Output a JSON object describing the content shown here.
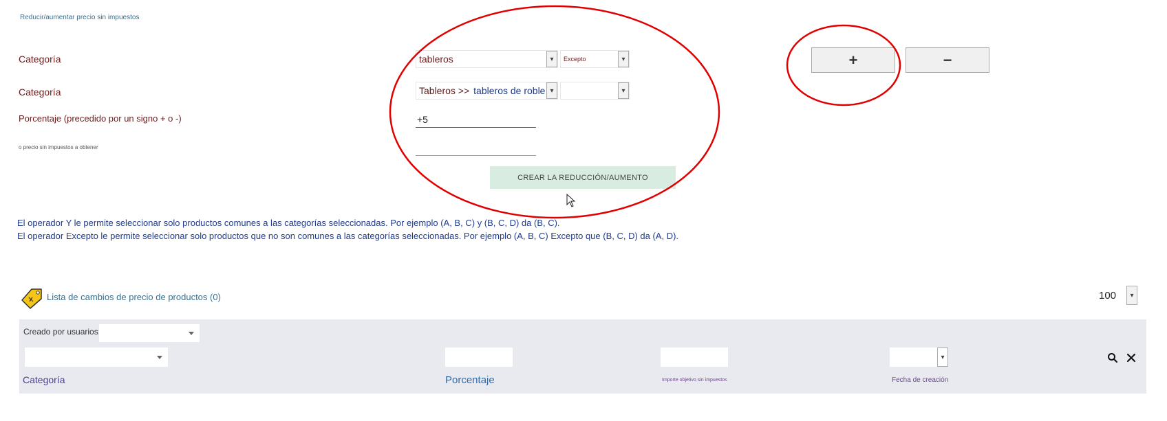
{
  "section_title": "Reducir/aumentar precio sin impuestos",
  "rows": [
    {
      "label": "Categoría",
      "select1": "tableros",
      "select2": "Excepto"
    },
    {
      "label": "Categoría",
      "select1_prefix": "Tableros >>",
      "select1": "tableros de roble",
      "select2": ""
    }
  ],
  "percentage": {
    "label": "Porcentaje (precedido por un signo + o -)",
    "value": "+5"
  },
  "target_price": {
    "label": "o precio sin impuestos a obtener",
    "value": ""
  },
  "create_button": "CREAR LA REDUCCIÓN/AUMENTO",
  "add_button": "+",
  "remove_button": "−",
  "info_lines": [
    "El operador Y le permite seleccionar solo productos comunes a las categorías seleccionadas. Por ejemplo (A, B, C) y (B, C, D) da (B, C).",
    "El operador Excepto le permite seleccionar solo productos que no son comunes a las categorías seleccionadas. Por ejemplo (A, B, C) Excepto que (B, C, D) da (A, D)."
  ],
  "list": {
    "title": "Lista de cambios de precio de productos (0)",
    "page_size": "100",
    "created_by_label": "Creado por usuarios:",
    "columns": {
      "category": "Categoría",
      "percentage": "Porcentaje",
      "target": "Importe objetivo sin impuestos",
      "created": "Fecha de creación"
    }
  },
  "colors": {
    "accent_red": "#e00000",
    "label_dark_red": "#6b1d1d",
    "info_blue": "#1f3b8c",
    "create_button_bg": "#d8ece1",
    "tag_yellow": "#f5c518",
    "filter_bg": "#e9eaef"
  },
  "icons": [
    "price-tag-icon",
    "search-icon",
    "close-icon",
    "chevron-down-icon"
  ]
}
